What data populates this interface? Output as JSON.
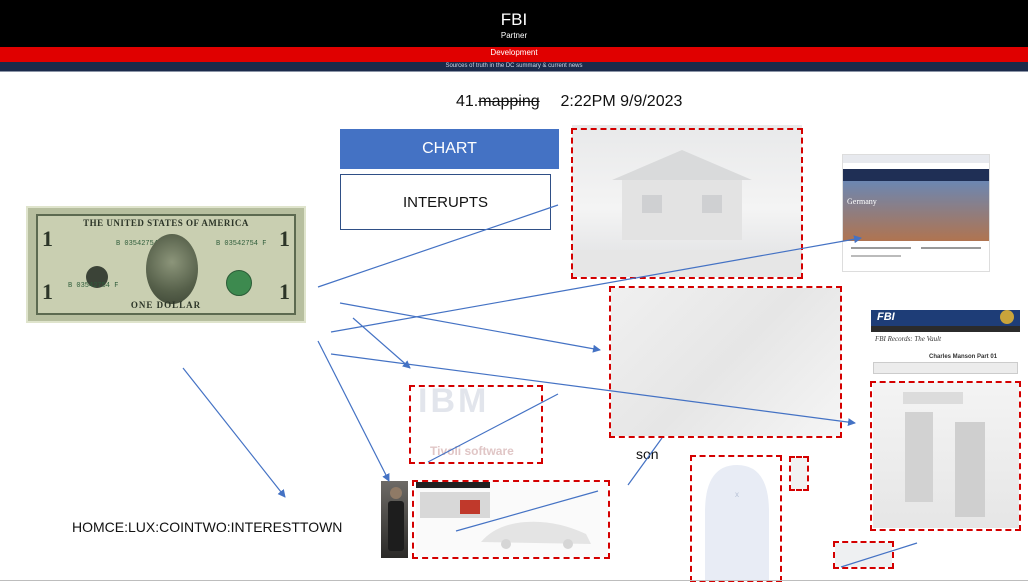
{
  "header": {
    "title": "FBI",
    "subtitle": "Partner"
  },
  "redbar": {
    "label": "Development"
  },
  "subbar": {
    "text": "Sources of truth in the DC summary & current news"
  },
  "heading": {
    "number": "41.",
    "struck_word": "mapping",
    "timestamp": "2:22PM 9/9/2023"
  },
  "buttons": {
    "chart_label": "CHART",
    "interupts_label": "INTERUPTS"
  },
  "labels": {
    "son": "son",
    "homce": "HOMCE:LUX:COINTWO:INTERESTTOWN"
  },
  "dollar_bill": {
    "top_text": "THE UNITED STATES OF AMERICA",
    "bottom_text": "ONE DOLLAR",
    "serial": "B 03542754 F",
    "reserve_letter": "B",
    "denomination": "1"
  },
  "vault": {
    "banner": "FBI",
    "subtitle": "FBI Records: The Vault",
    "doc_title": "Charles Manson Part 01"
  },
  "germany_page": {
    "heading": "Germany"
  },
  "ibm": {
    "word": "IBM",
    "tagline": "Tivoli software"
  },
  "colors": {
    "header_bg": "#000000",
    "accent_red": "#e00000",
    "chart_blue": "#4472c4",
    "arrow_blue": "#4472c4",
    "dashed_red": "#d40000"
  }
}
